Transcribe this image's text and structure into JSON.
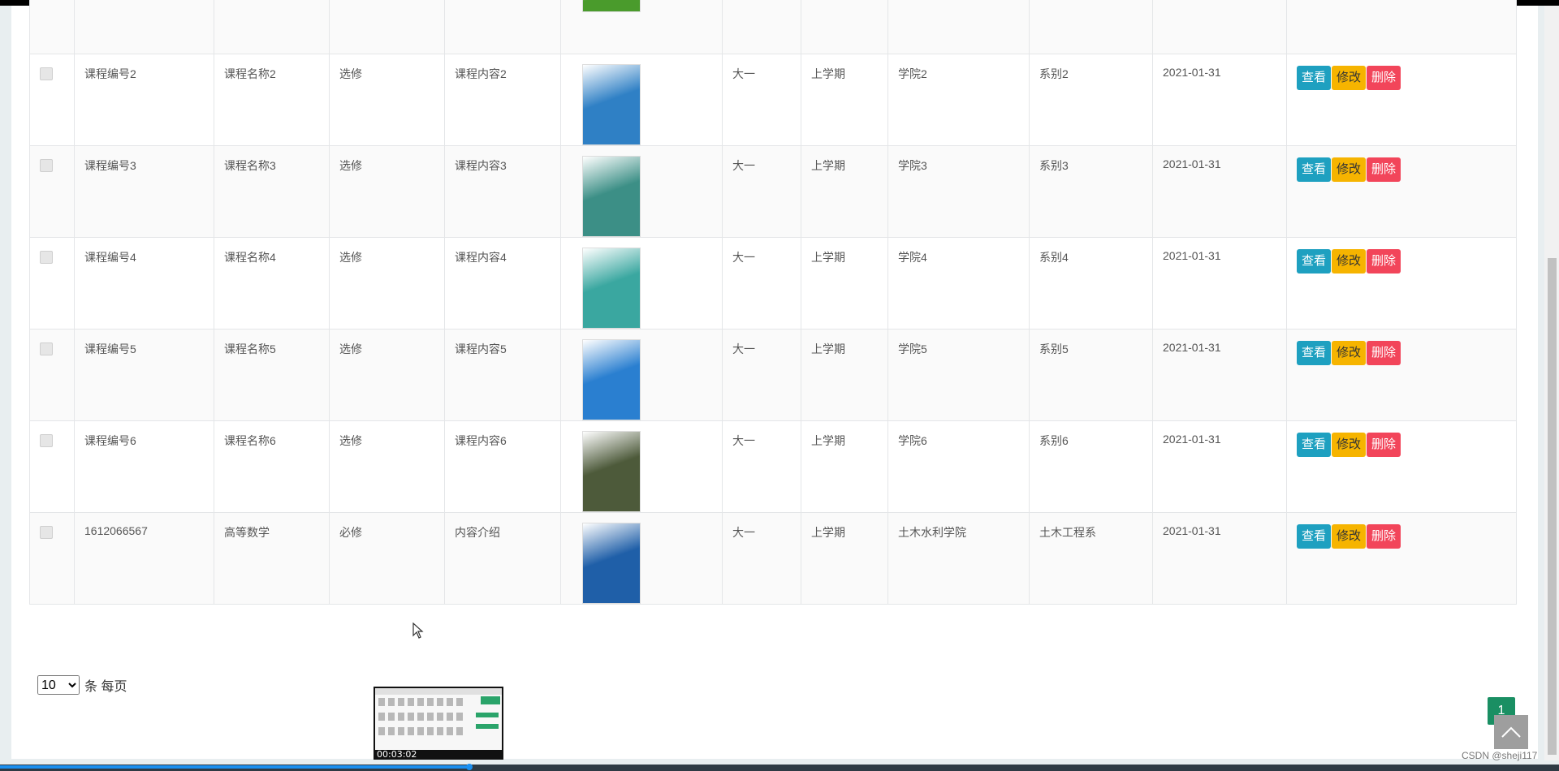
{
  "table": {
    "rows": [
      {
        "id": "",
        "name": "",
        "type": "",
        "content": "",
        "grade": "",
        "term": "",
        "college": "",
        "dept": "",
        "date": "",
        "cover_color": "#4a9b2c"
      },
      {
        "id": "课程编号2",
        "name": "课程名称2",
        "type": "选修",
        "content": "课程内容2",
        "grade": "大一",
        "term": "上学期",
        "college": "学院2",
        "dept": "系别2",
        "date": "2021-01-31",
        "cover_color": "#2f80c5"
      },
      {
        "id": "课程编号3",
        "name": "课程名称3",
        "type": "选修",
        "content": "课程内容3",
        "grade": "大一",
        "term": "上学期",
        "college": "学院3",
        "dept": "系别3",
        "date": "2021-01-31",
        "cover_color": "#3c8f86"
      },
      {
        "id": "课程编号4",
        "name": "课程名称4",
        "type": "选修",
        "content": "课程内容4",
        "grade": "大一",
        "term": "上学期",
        "college": "学院4",
        "dept": "系别4",
        "date": "2021-01-31",
        "cover_color": "#3aa7a0"
      },
      {
        "id": "课程编号5",
        "name": "课程名称5",
        "type": "选修",
        "content": "课程内容5",
        "grade": "大一",
        "term": "上学期",
        "college": "学院5",
        "dept": "系别5",
        "date": "2021-01-31",
        "cover_color": "#2a7fd0"
      },
      {
        "id": "课程编号6",
        "name": "课程名称6",
        "type": "选修",
        "content": "课程内容6",
        "grade": "大一",
        "term": "上学期",
        "college": "学院6",
        "dept": "系别6",
        "date": "2021-01-31",
        "cover_color": "#4d5a3a"
      },
      {
        "id": "1612066567",
        "name": "高等数学",
        "type": "必修",
        "content": "内容介绍",
        "grade": "大一",
        "term": "上学期",
        "college": "土木水利学院",
        "dept": "土木工程系",
        "date": "2021-01-31",
        "cover_color": "#1f5fa8"
      }
    ],
    "actions": {
      "view": "查看",
      "edit": "修改",
      "delete": "删除"
    }
  },
  "pager": {
    "page_size": "10",
    "per_page_label": "条 每页",
    "current_page": "1",
    "options": [
      "10"
    ]
  },
  "video": {
    "timestamp": "00:03:02"
  },
  "watermark": "CSDN @sheji117",
  "colors": {
    "view": "#1ea0c0",
    "edit": "#f6b400",
    "delete": "#f2455a",
    "badge": "#1a8f63"
  }
}
